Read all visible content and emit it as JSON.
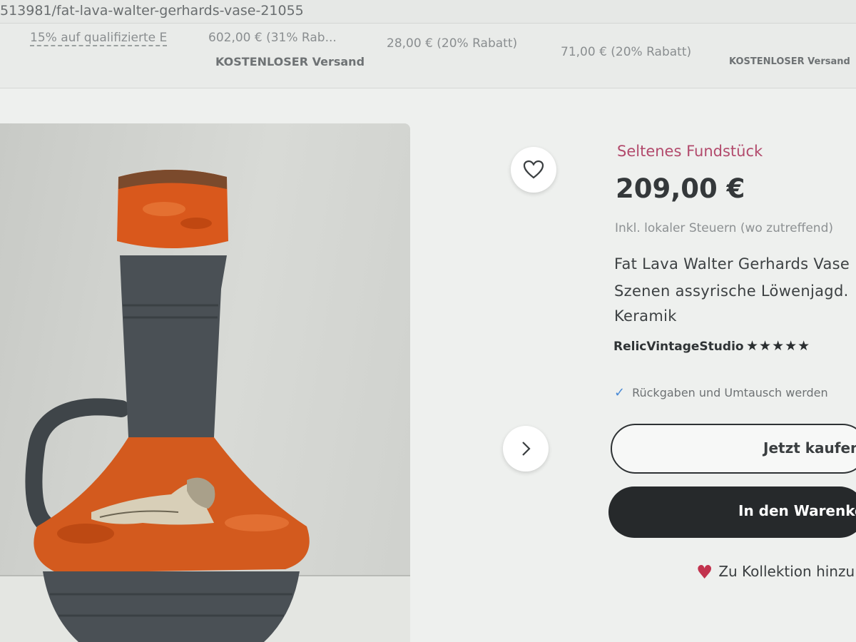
{
  "browser": {
    "url": "513981/fat-lava-walter-gerhards-vase-21055"
  },
  "recommendations": {
    "item1_text": "15% auf qualifizierte E",
    "item2_price": "602,00 € (31% Rab...",
    "item2_shipping": "KOSTENLOSER Versand",
    "item3_price": "28,00 € (20% Rabatt)",
    "item4_price": "71,00 € (20% Rabatt)",
    "item4_shipping": "KOSTENLOSER Versand"
  },
  "gallery": {
    "image_alt": "Fat Lava Walter Gerhards Vase mit Löwe",
    "favorite_icon": "heart-outline-icon",
    "next_icon": "chevron-right-icon"
  },
  "product": {
    "badge": "Seltenes Fundstück",
    "price": "209,00 €",
    "tax_note": "Inkl. lokaler Steuern (wo zutreffend)",
    "title_lines": [
      "Fat Lava Walter Gerhards Vase",
      "Szenen assyrische Löwenjagd.",
      "Keramik"
    ],
    "shop_name": "RelicVintageStudio",
    "rating_stars": "★★★★★",
    "rating": 5,
    "returns_text": "Rückgaben und Umtausch werden",
    "buy_now_label": "Jetzt kaufen",
    "add_to_cart_label": "In den Warenkor",
    "collection_label": "Zu Kollektion hinzu"
  },
  "colors": {
    "badge": "#b24a6c",
    "cart_button": "#26292b",
    "heart": "#c2334e",
    "check": "#4a8ad6",
    "glaze_orange": "#d9581c",
    "clay_gray": "#4a5055"
  }
}
